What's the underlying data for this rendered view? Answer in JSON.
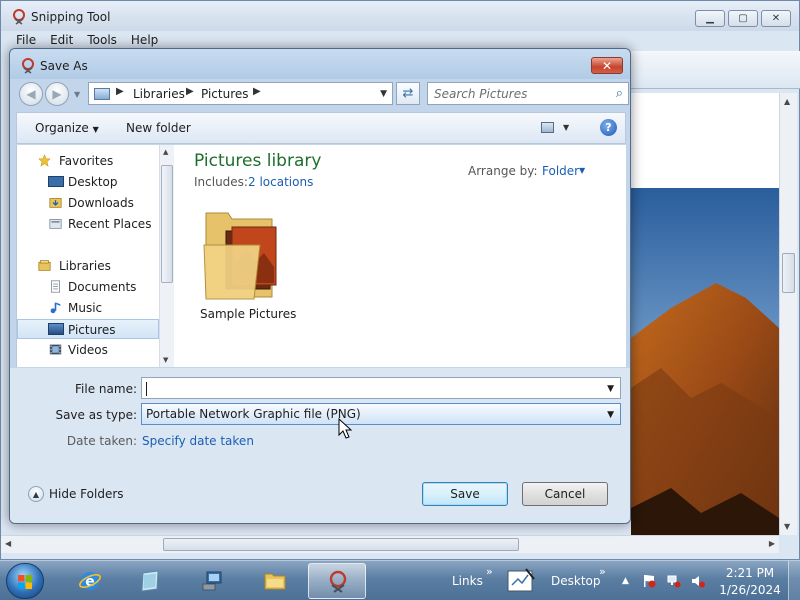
{
  "snipping_tool": {
    "title": "Snipping Tool",
    "menu": [
      "File",
      "Edit",
      "Tools",
      "Help"
    ]
  },
  "dialog": {
    "title": "Save As",
    "address": {
      "crumbs": [
        "Libraries",
        "Pictures"
      ]
    },
    "search": {
      "placeholder": "Search Pictures"
    },
    "command_bar": {
      "organize": "Organize",
      "new_folder": "New folder"
    },
    "nav": {
      "favorites": "Favorites",
      "favorites_items": [
        "Desktop",
        "Downloads",
        "Recent Places"
      ],
      "libraries": "Libraries",
      "libraries_items": [
        "Documents",
        "Music",
        "Pictures",
        "Videos"
      ],
      "selected": "Pictures"
    },
    "library": {
      "title": "Pictures library",
      "includes_label": "Includes:",
      "includes_link": "2 locations",
      "arrange_label": "Arrange by:",
      "arrange_value": "Folder",
      "items": [
        {
          "name": "Sample Pictures"
        }
      ]
    },
    "fields": {
      "file_name_label": "File name:",
      "file_name_value": "",
      "save_type_label": "Save as type:",
      "save_type_value": "Portable Network Graphic file (PNG)",
      "date_label": "Date taken:",
      "date_link": "Specify date taken"
    },
    "hide_folders": "Hide Folders",
    "save": "Save",
    "cancel": "Cancel"
  },
  "taskbar": {
    "links": "Links",
    "desktop": "Desktop",
    "time": "2:21 PM",
    "date": "1/26/2024",
    "chevron": "»"
  }
}
